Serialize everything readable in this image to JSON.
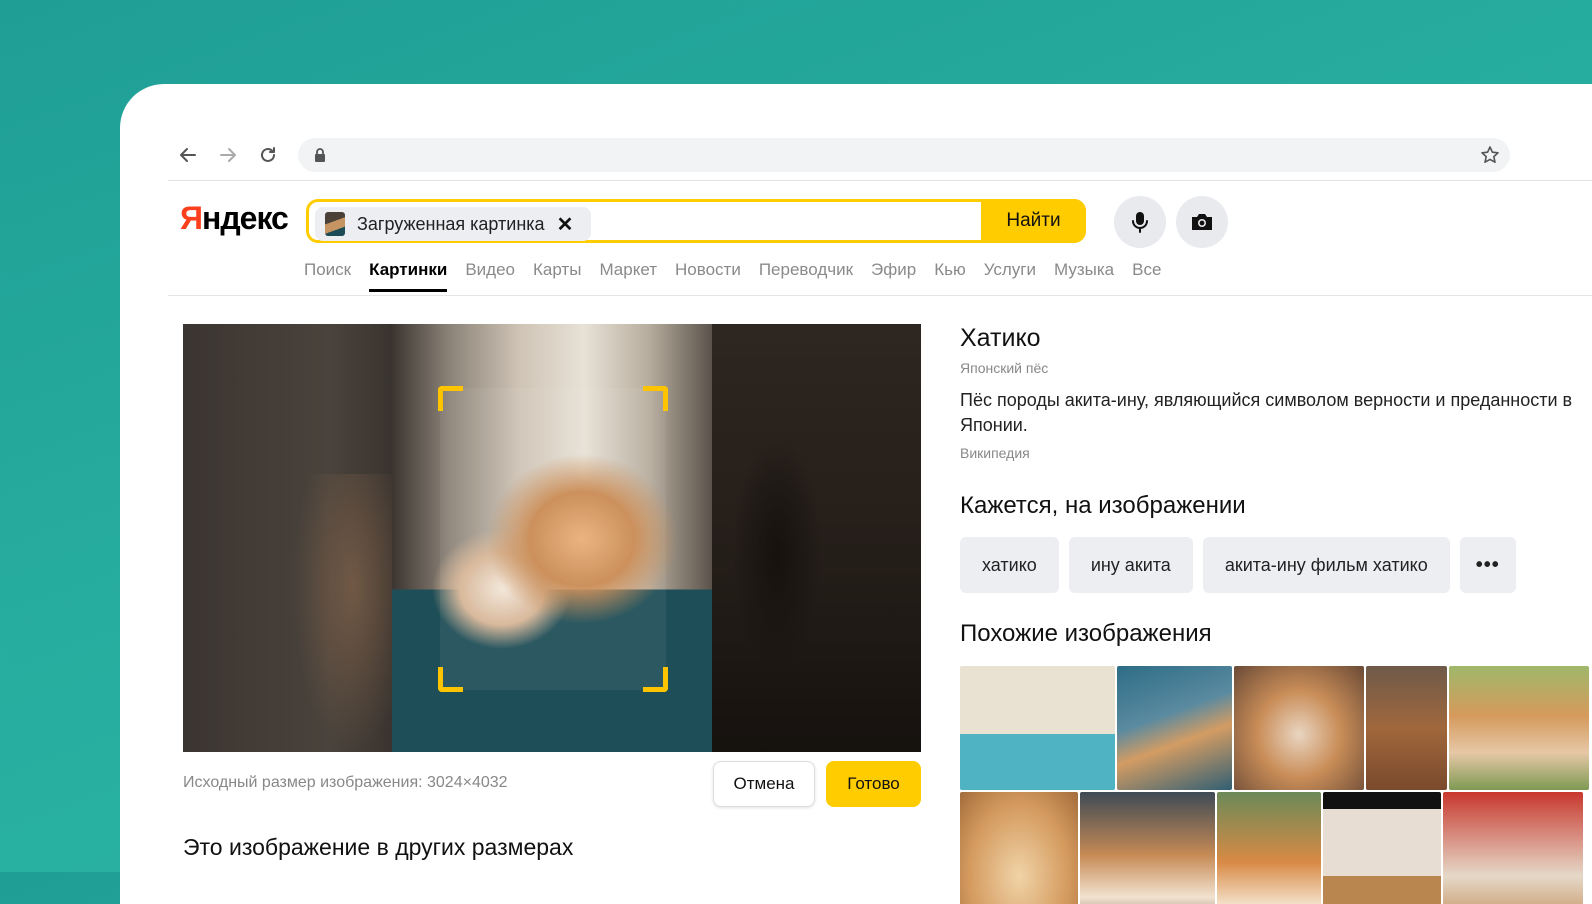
{
  "browser": {
    "back_icon": "arrow-left-icon",
    "forward_icon": "arrow-right-icon",
    "reload_icon": "reload-icon",
    "lock_icon": "lock-icon",
    "star_icon": "star-icon",
    "url": ""
  },
  "header": {
    "logo_first": "Я",
    "logo_rest": "ндекс",
    "search_chip_label": "Загруженная картинка",
    "search_chip_close": "✕",
    "search_button": "Найти",
    "mic_icon": "microphone-icon",
    "camera_icon": "camera-icon"
  },
  "tabs": [
    {
      "label": "Поиск",
      "active": false
    },
    {
      "label": "Картинки",
      "active": true
    },
    {
      "label": "Видео",
      "active": false
    },
    {
      "label": "Карты",
      "active": false
    },
    {
      "label": "Маркет",
      "active": false
    },
    {
      "label": "Новости",
      "active": false
    },
    {
      "label": "Переводчик",
      "active": false
    },
    {
      "label": "Эфир",
      "active": false
    },
    {
      "label": "Кью",
      "active": false
    },
    {
      "label": "Услуги",
      "active": false
    },
    {
      "label": "Музыка",
      "active": false
    },
    {
      "label": "Все",
      "active": false
    }
  ],
  "viewer": {
    "original_size": "Исходный размер изображения: 3024×4032",
    "cancel_button": "Отмена",
    "done_button": "Готово",
    "other_sizes_title": "Это изображение в других размерах"
  },
  "entity": {
    "title": "Хатико",
    "subtitle": "Японский пёс",
    "description": "Пёс породы акита-ину, являющийся символом верности и преданности в Японии.",
    "source": "Википедия"
  },
  "tags_section": {
    "title": "Кажется, на изображении",
    "tags": [
      "хатико",
      "ину акита",
      "акита-ину фильм хатико"
    ],
    "more_label": "•••"
  },
  "similar_section": {
    "title": "Похожие изображения"
  },
  "colors": {
    "accent": "#ffcc00",
    "logo_red": "#fc3f1d",
    "background": "#26a89c"
  }
}
